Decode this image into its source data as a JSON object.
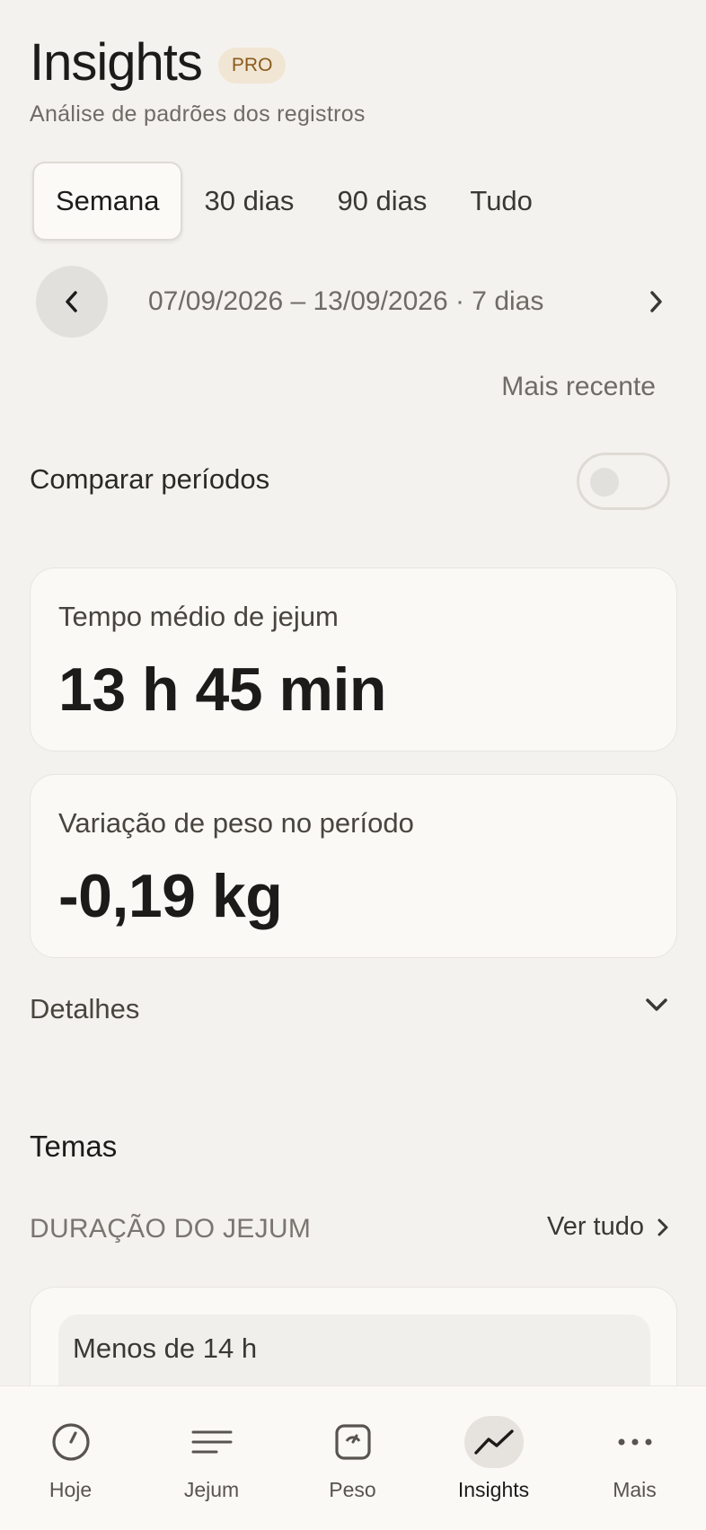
{
  "header": {
    "title": "Insights",
    "badge": "PRO",
    "subtitle": "Análise de padrões dos registros"
  },
  "tabs": [
    {
      "label": "Semana",
      "active": true
    },
    {
      "label": "30 dias",
      "active": false
    },
    {
      "label": "90 dias",
      "active": false
    },
    {
      "label": "Tudo",
      "active": false
    }
  ],
  "date_nav": {
    "range": "07/09/2026 – 13/09/2026 · 7 dias",
    "prev_icon": "chevron-left-icon",
    "next_icon": "chevron-right-icon"
  },
  "most_recent": "Mais recente",
  "compare": {
    "label": "Comparar períodos",
    "enabled": false
  },
  "cards": [
    {
      "label": "Tempo médio de jejum",
      "value": "13 h 45 min"
    },
    {
      "label": "Variação de peso no período",
      "value": "-0,19 kg"
    }
  ],
  "details": {
    "label": "Detalhes",
    "icon": "chevron-down-icon"
  },
  "themes": {
    "title": "Temas",
    "heading": "DURAÇÃO DO JEJUM",
    "see_all": "Ver tudo",
    "item_label": "Menos de 14 h"
  },
  "bottom_nav": [
    {
      "label": "Hoje",
      "icon": "clock-icon",
      "active": false
    },
    {
      "label": "Jejum",
      "icon": "list-lines-icon",
      "active": false
    },
    {
      "label": "Peso",
      "icon": "scale-icon",
      "active": false
    },
    {
      "label": "Insights",
      "icon": "trend-line-icon",
      "active": true
    },
    {
      "label": "Mais",
      "icon": "more-dots-icon",
      "active": false
    }
  ],
  "colors": {
    "background": "#f4f2ee",
    "card": "#faf9f5",
    "badge_bg": "#f1e6d3",
    "badge_text": "#8a5a1c",
    "text_primary": "#1c1b19",
    "text_muted": "#6f6b66"
  }
}
